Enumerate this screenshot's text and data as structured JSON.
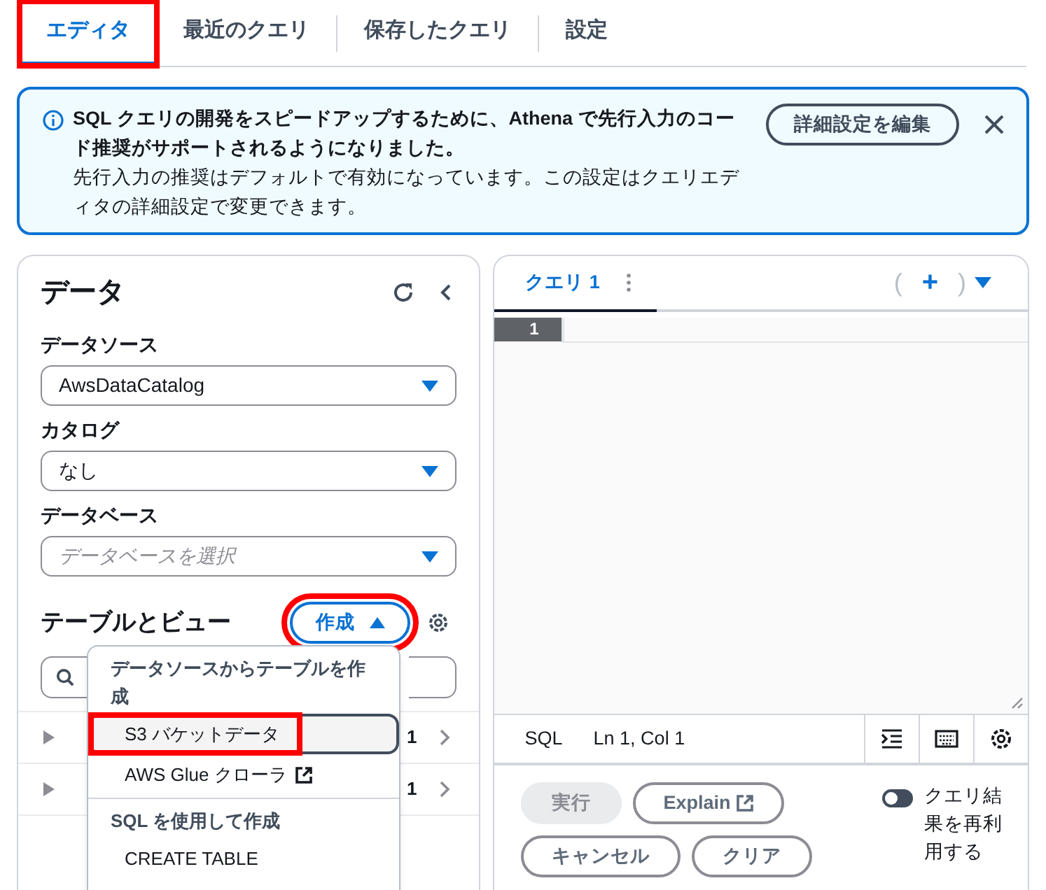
{
  "tabs": [
    {
      "label": "エディタ",
      "selected": true,
      "highlighted": true
    },
    {
      "label": "最近のクエリ",
      "selected": false,
      "highlighted": false
    },
    {
      "label": "保存したクエリ",
      "selected": false,
      "highlighted": false
    },
    {
      "label": "設定",
      "selected": false,
      "highlighted": false
    }
  ],
  "info_banner": {
    "title": "SQL クエリの開発をスピードアップするために、Athena で先行入力のコード推奨がサポートされるようになりました。",
    "message": "先行入力の推奨はデフォルトで有効になっています。この設定はクエリエディタの詳細設定で変更できます。",
    "button": "詳細設定を編集"
  },
  "data_panel": {
    "title": "データ",
    "fields": [
      {
        "label": "データソース",
        "value": "AwsDataCatalog"
      },
      {
        "label": "カタログ",
        "value": "なし"
      },
      {
        "label": "データベース",
        "placeholder": "データベースを選択"
      }
    ],
    "tables_title": "テーブルとビュー",
    "create_button": {
      "label": "作成",
      "highlighted": true
    },
    "tree_rows": [
      {
        "count": "1"
      },
      {
        "count": "1"
      }
    ]
  },
  "create_menu": {
    "groups": [
      {
        "heading": "データソースからテーブルを作成",
        "items": [
          {
            "label": "S3 バケットデータ",
            "selected": true,
            "highlighted": true,
            "external": false
          },
          {
            "label": "AWS Glue クローラ",
            "selected": false,
            "highlighted": false,
            "external": true
          }
        ]
      },
      {
        "heading": "SQL を使用して作成",
        "items": [
          {
            "label": "CREATE TABLE",
            "selected": false,
            "highlighted": false,
            "external": false
          }
        ]
      }
    ]
  },
  "editor": {
    "tabs": [
      {
        "label": "クエリ 1",
        "selected": true
      }
    ],
    "add_tab": [
      "(",
      "+",
      ")"
    ],
    "line_numbers": [
      "1"
    ],
    "status": {
      "language": "SQL",
      "position": "Ln 1, Col 1"
    },
    "actions": [
      {
        "label": "実行",
        "disabled": true,
        "external": false
      },
      {
        "label": "Explain",
        "disabled": false,
        "external": true
      },
      {
        "label": "キャンセル",
        "disabled": false,
        "external": false
      },
      {
        "label": "クリア",
        "disabled": false,
        "external": false
      }
    ],
    "reuse_toggle": {
      "label": "クエリ結果を再利用する",
      "on": false
    }
  }
}
